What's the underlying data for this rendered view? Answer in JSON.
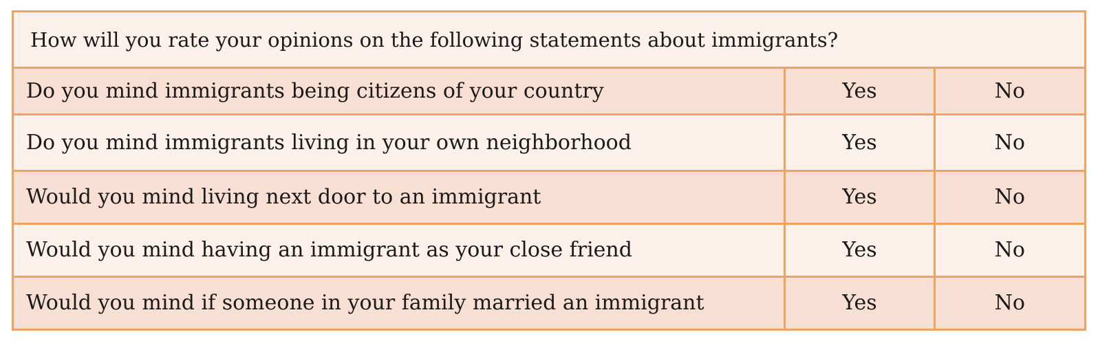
{
  "survey": {
    "header": "How will you rate your opinions on the following statements about immigrants?",
    "rows": [
      {
        "question": "Do you mind immigrants being citizens of your country",
        "yes_label": "Yes",
        "no_label": "No"
      },
      {
        "question": "Do you mind immigrants living in your own neighborhood",
        "yes_label": "Yes",
        "no_label": "No"
      },
      {
        "question": "Would you mind living next door to an immigrant",
        "yes_label": "Yes",
        "no_label": "No"
      },
      {
        "question": "Would you mind having an immigrant as your close friend",
        "yes_label": "Yes",
        "no_label": "No"
      },
      {
        "question": "Would you mind if someone in your family married an immigrant",
        "yes_label": "Yes",
        "no_label": "No"
      }
    ]
  },
  "colors": {
    "border": "#f0a35e",
    "row_shaded": "#f8dfd3",
    "row_light": "#fcf0ea"
  }
}
